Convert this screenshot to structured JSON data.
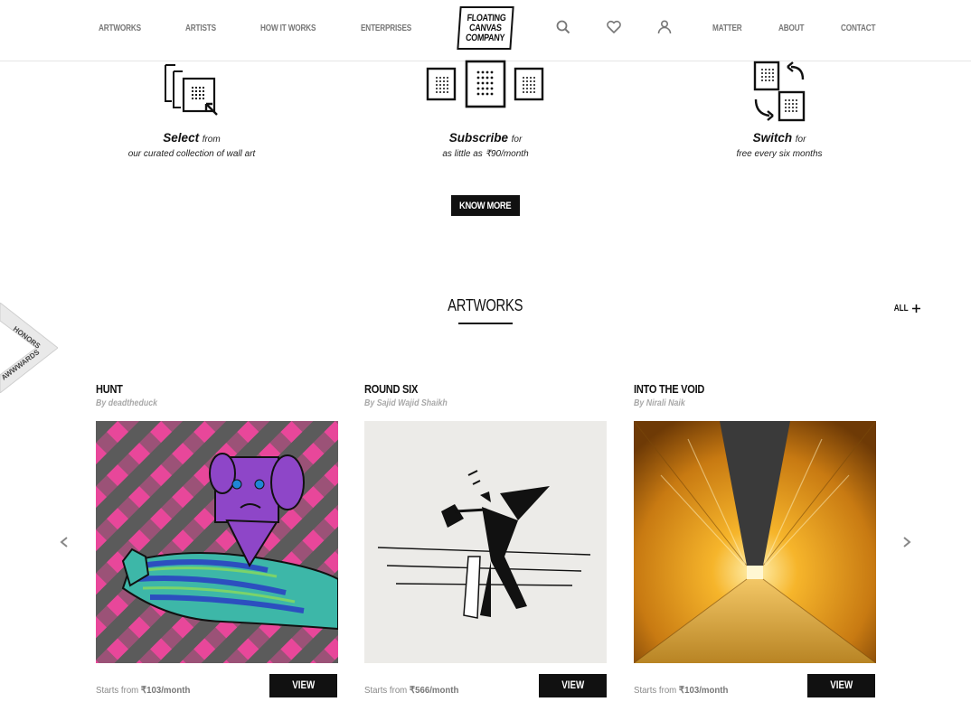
{
  "header": {
    "nav_left": [
      "ARTWORKS",
      "ARTISTS",
      "HOW IT WORKS",
      "ENTERPRISES"
    ],
    "logo_lines": [
      "FLOATING",
      "CANVAS",
      "COMPANY"
    ],
    "icons": [
      "search-icon",
      "heart-icon",
      "user-icon"
    ],
    "nav_right": [
      "MATTER",
      "ABOUT",
      "CONTACT"
    ]
  },
  "how_it_works": {
    "steps": [
      {
        "title": "Select",
        "connector": "from",
        "subtitle": "our curated collection of wall art",
        "icon": "select-frames-icon"
      },
      {
        "title": "Subscribe",
        "connector": "for",
        "subtitle": "as little as  ₹90/month",
        "icon": "subscribe-frames-icon"
      },
      {
        "title": "Switch",
        "connector": "for",
        "subtitle": "free every six months",
        "icon": "switch-frames-icon"
      }
    ],
    "cta_label": "KNOW MORE"
  },
  "artworks": {
    "title": "ARTWORKS",
    "all_label": "ALL",
    "cards": [
      {
        "title": "HUNT",
        "by_prefix": "By",
        "artist": "deadtheduck",
        "price_prefix": "Starts from",
        "price": "₹103/month",
        "view_label": "VIEW"
      },
      {
        "title": "ROUND SIX",
        "by_prefix": "By",
        "artist": "Sajid Wajid Shaikh",
        "price_prefix": "Starts from",
        "price": "₹566/month",
        "view_label": "VIEW"
      },
      {
        "title": "INTO THE VOID",
        "by_prefix": "By",
        "artist": "Nirali Naik",
        "price_prefix": "Starts from",
        "price": "₹103/month",
        "view_label": "VIEW"
      }
    ]
  },
  "ribbon": {
    "line1": "HONORS",
    "line2": "AWWWARDS"
  },
  "colors": {
    "accent": "#111111",
    "muted": "#a8a8a8",
    "ribbon_green": "#4caf50"
  }
}
